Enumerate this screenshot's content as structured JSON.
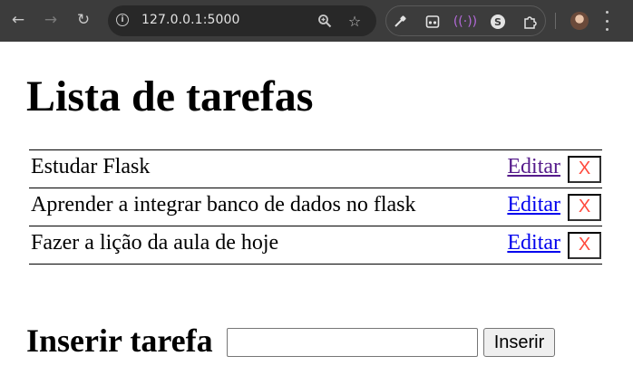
{
  "browser": {
    "url": "127.0.0.1:5000",
    "icons": {
      "back": "arrow-left-icon",
      "forward": "arrow-right-icon",
      "reload": "reload-icon",
      "site_info": "info-icon",
      "zoom": "zoom-icon",
      "bookmark": "star-icon",
      "extensions": [
        "eyedropper-icon",
        "extension-icon",
        "podcast-icon",
        "s-extension-icon",
        "puzzle-icon"
      ],
      "profile": "avatar",
      "menu": "kebab-menu-icon"
    }
  },
  "page": {
    "title": "Lista de tarefas",
    "tasks": [
      {
        "text": "Estudar Flask",
        "edit_label": "Editar",
        "delete_label": "X"
      },
      {
        "text": "Aprender a integrar banco de dados no flask",
        "edit_label": "Editar",
        "delete_label": "X"
      },
      {
        "text": "Fazer a lição da aula de hoje",
        "edit_label": "Editar",
        "delete_label": "X"
      }
    ],
    "insert_heading": "Inserir tarefa",
    "insert_input_value": "",
    "insert_button_label": "Inserir"
  },
  "colors": {
    "chrome_bg": "#3c3c3c",
    "link": "#0000ee",
    "link_visited": "#551a8b",
    "delete_text": "#ff4a3d"
  }
}
